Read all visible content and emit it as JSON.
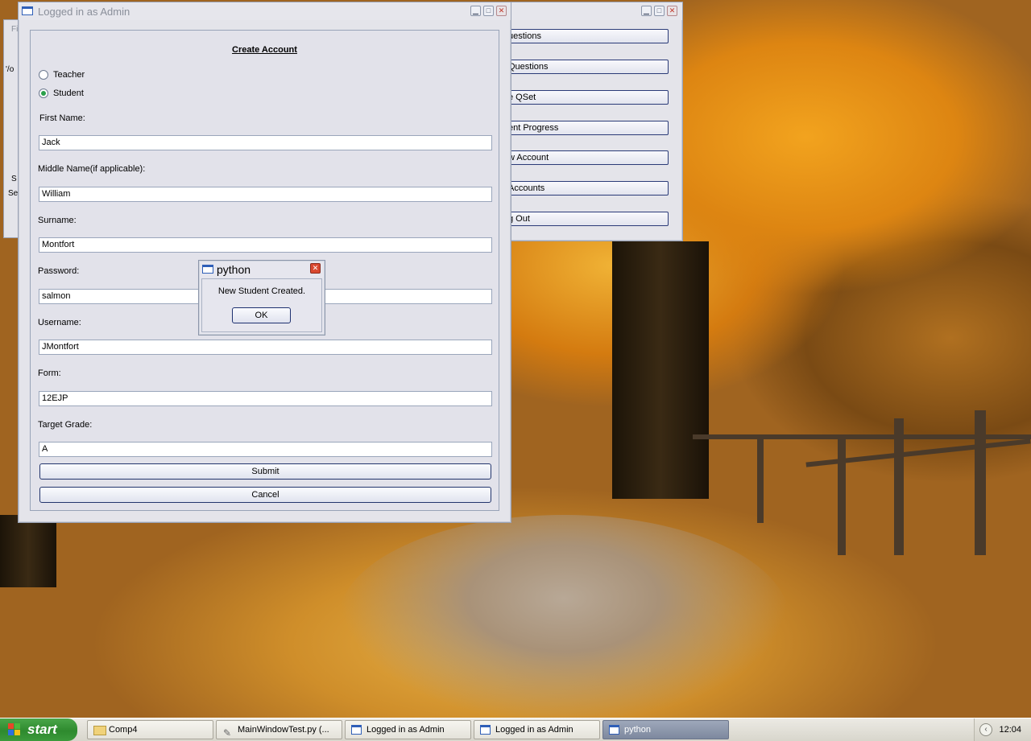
{
  "back_window": {
    "menu_items": [
      "uestions",
      "Questions",
      "e QSet",
      "ent Progress",
      "w Account",
      "Accounts",
      "g Out"
    ]
  },
  "left_sliver": {
    "fragments": [
      "Fi",
      "'/o",
      "S",
      "Se"
    ]
  },
  "form_window": {
    "title": "Logged in as Admin",
    "heading": "Create Account",
    "account_types": [
      {
        "label": "Teacher",
        "checked": false
      },
      {
        "label": "Student",
        "checked": true
      }
    ],
    "fields": {
      "first_name": {
        "label": "First Name:",
        "value": "Jack"
      },
      "middle_name": {
        "label": "Middle Name(if applicable):",
        "value": "William"
      },
      "surname": {
        "label": "Surname:",
        "value": "Montfort"
      },
      "password": {
        "label": "Password:",
        "value": "salmon"
      },
      "username": {
        "label": "Username:",
        "value": "JMontfort"
      },
      "form": {
        "label": "Form:",
        "value": "12EJP"
      },
      "target_grade": {
        "label": "Target Grade:",
        "value": "A"
      }
    },
    "submit_label": "Submit",
    "cancel_label": "Cancel"
  },
  "message_box": {
    "title": "python",
    "text": "New Student Created.",
    "ok_label": "OK"
  },
  "taskbar": {
    "start_label": "start",
    "tasks": [
      {
        "label": "Comp4",
        "icon": "folder-icon",
        "active": false
      },
      {
        "label": "MainWindowTest.py (...",
        "icon": "editor-icon",
        "active": false
      },
      {
        "label": "Logged in as Admin",
        "icon": "window-icon",
        "active": false
      },
      {
        "label": "Logged in as Admin",
        "icon": "window-icon",
        "active": false
      },
      {
        "label": "python",
        "icon": "window-icon",
        "active": true
      }
    ],
    "clock": "12:04"
  }
}
